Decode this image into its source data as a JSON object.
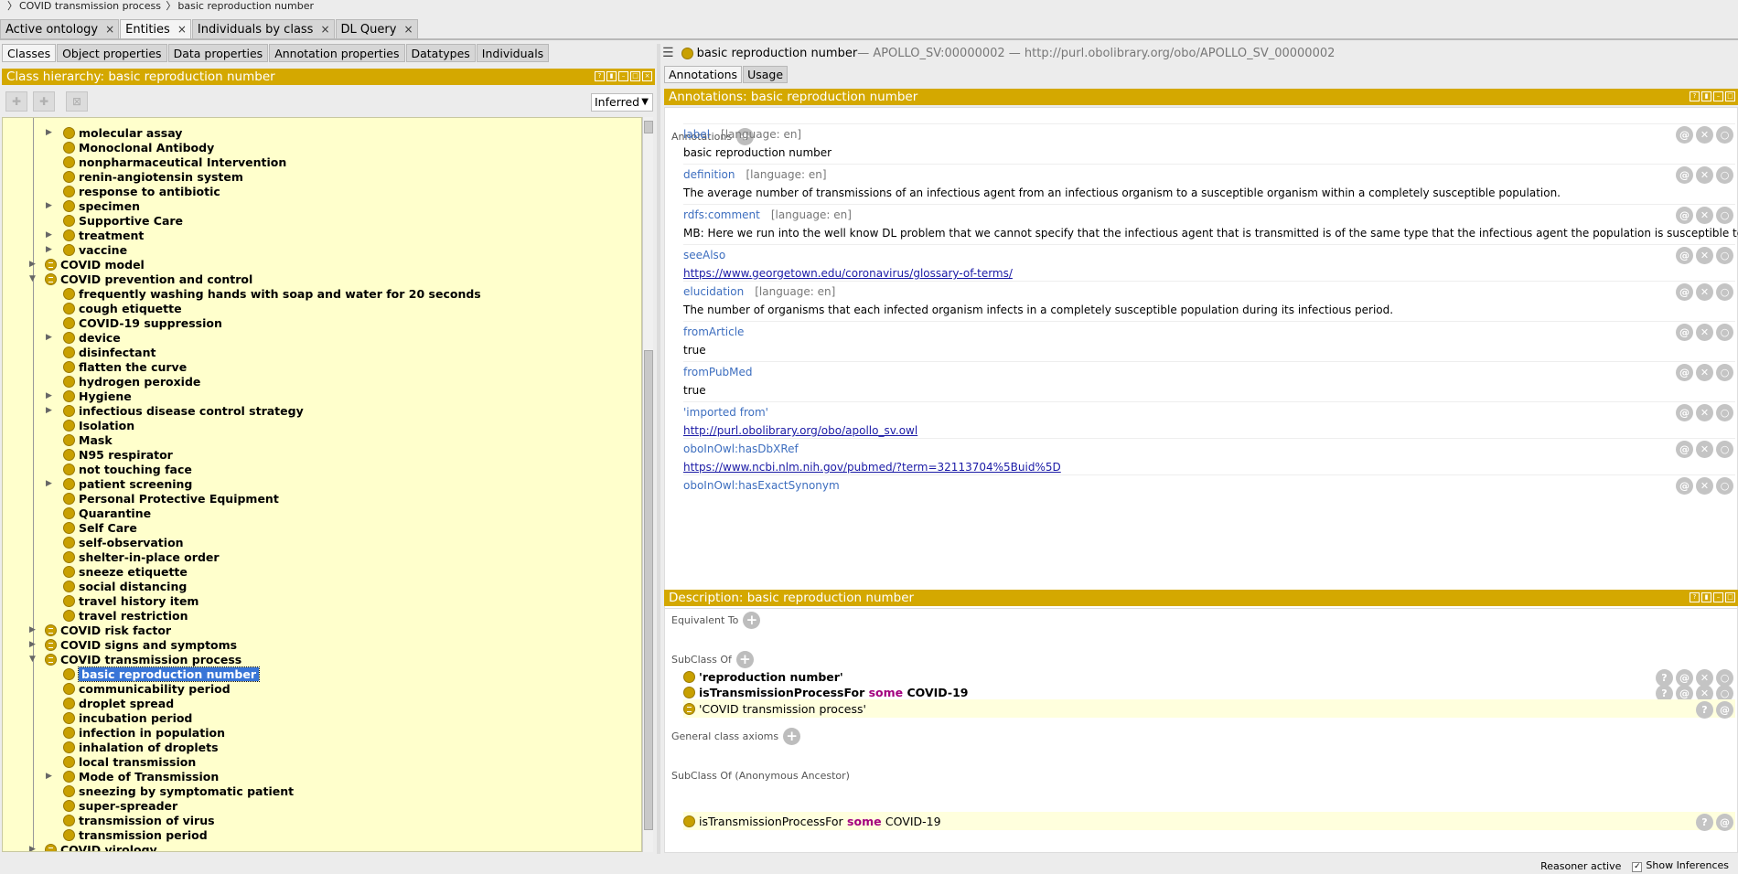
{
  "breadcrumb": [
    "COVID transmission process",
    "basic reproduction number"
  ],
  "top_tabs": [
    {
      "label": "Active ontology",
      "active": false
    },
    {
      "label": "Entities",
      "active": true
    },
    {
      "label": "Individuals by class",
      "active": false
    },
    {
      "label": "DL Query",
      "active": false
    }
  ],
  "left": {
    "sub_tabs": [
      "Classes",
      "Object properties",
      "Data properties",
      "Annotation properties",
      "Datatypes",
      "Individuals"
    ],
    "title": "Class hierarchy: basic reproduction number",
    "inferred": "Inferred",
    "tree": [
      {
        "label": "molecular assay",
        "depth": 2,
        "toggle": "collapsed",
        "type": "class",
        "bold": true
      },
      {
        "label": "Monoclonal Antibody",
        "depth": 2,
        "toggle": "",
        "type": "class"
      },
      {
        "label": "nonpharmaceutical Intervention",
        "depth": 2,
        "toggle": "",
        "type": "class"
      },
      {
        "label": "renin-angiotensin system",
        "depth": 2,
        "toggle": "",
        "type": "class"
      },
      {
        "label": "response to antibiotic",
        "depth": 2,
        "toggle": "",
        "type": "class"
      },
      {
        "label": "specimen",
        "depth": 2,
        "toggle": "collapsed",
        "type": "class"
      },
      {
        "label": "Supportive Care",
        "depth": 2,
        "toggle": "",
        "type": "class"
      },
      {
        "label": "treatment",
        "depth": 2,
        "toggle": "collapsed",
        "type": "class"
      },
      {
        "label": "vaccine",
        "depth": 2,
        "toggle": "collapsed",
        "type": "class"
      },
      {
        "label": "COVID model",
        "depth": 1,
        "toggle": "collapsed",
        "type": "eq"
      },
      {
        "label": "COVID prevention and control",
        "depth": 1,
        "toggle": "expanded",
        "type": "eq"
      },
      {
        "label": " frequently washing hands with soap and water for 20 seconds",
        "depth": 2,
        "toggle": "",
        "type": "class"
      },
      {
        "label": "cough etiquette",
        "depth": 2,
        "toggle": "",
        "type": "class"
      },
      {
        "label": "COVID-19 suppression",
        "depth": 2,
        "toggle": "",
        "type": "class"
      },
      {
        "label": "device",
        "depth": 2,
        "toggle": "collapsed",
        "type": "class"
      },
      {
        "label": "disinfectant",
        "depth": 2,
        "toggle": "",
        "type": "class"
      },
      {
        "label": "flatten the curve",
        "depth": 2,
        "toggle": "",
        "type": "class"
      },
      {
        "label": "hydrogen peroxide",
        "depth": 2,
        "toggle": "",
        "type": "class"
      },
      {
        "label": "Hygiene",
        "depth": 2,
        "toggle": "collapsed",
        "type": "class"
      },
      {
        "label": "infectious disease control strategy",
        "depth": 2,
        "toggle": "collapsed",
        "type": "class"
      },
      {
        "label": "Isolation",
        "depth": 2,
        "toggle": "",
        "type": "class"
      },
      {
        "label": "Mask",
        "depth": 2,
        "toggle": "",
        "type": "class"
      },
      {
        "label": "N95 respirator",
        "depth": 2,
        "toggle": "",
        "type": "class"
      },
      {
        "label": "not touching face",
        "depth": 2,
        "toggle": "",
        "type": "class"
      },
      {
        "label": "patient screening",
        "depth": 2,
        "toggle": "collapsed",
        "type": "class"
      },
      {
        "label": "Personal Protective Equipment",
        "depth": 2,
        "toggle": "",
        "type": "class"
      },
      {
        "label": "Quarantine",
        "depth": 2,
        "toggle": "",
        "type": "class"
      },
      {
        "label": "Self Care",
        "depth": 2,
        "toggle": "",
        "type": "class"
      },
      {
        "label": "self-observation",
        "depth": 2,
        "toggle": "",
        "type": "class"
      },
      {
        "label": "shelter-in-place order",
        "depth": 2,
        "toggle": "",
        "type": "class"
      },
      {
        "label": "sneeze etiquette",
        "depth": 2,
        "toggle": "",
        "type": "class"
      },
      {
        "label": "social distancing",
        "depth": 2,
        "toggle": "",
        "type": "class"
      },
      {
        "label": "travel history item",
        "depth": 2,
        "toggle": "",
        "type": "class"
      },
      {
        "label": "travel restriction",
        "depth": 2,
        "toggle": "",
        "type": "class"
      },
      {
        "label": "COVID risk factor",
        "depth": 1,
        "toggle": "collapsed",
        "type": "eq"
      },
      {
        "label": "COVID signs and symptoms",
        "depth": 1,
        "toggle": "collapsed",
        "type": "eq"
      },
      {
        "label": "COVID transmission process",
        "depth": 1,
        "toggle": "expanded",
        "type": "eq"
      },
      {
        "label": "basic reproduction number",
        "depth": 2,
        "toggle": "",
        "type": "class",
        "selected": true
      },
      {
        "label": "communicability period",
        "depth": 2,
        "toggle": "",
        "type": "class"
      },
      {
        "label": "droplet spread",
        "depth": 2,
        "toggle": "",
        "type": "class"
      },
      {
        "label": "incubation period",
        "depth": 2,
        "toggle": "",
        "type": "class"
      },
      {
        "label": "infection in population",
        "depth": 2,
        "toggle": "",
        "type": "class"
      },
      {
        "label": "inhalation of droplets",
        "depth": 2,
        "toggle": "",
        "type": "class"
      },
      {
        "label": "local transmission",
        "depth": 2,
        "toggle": "",
        "type": "class"
      },
      {
        "label": "Mode of Transmission",
        "depth": 2,
        "toggle": "collapsed",
        "type": "class"
      },
      {
        "label": "sneezing by symptomatic patient",
        "depth": 2,
        "toggle": "",
        "type": "class"
      },
      {
        "label": "super-spreader",
        "depth": 2,
        "toggle": "",
        "type": "class"
      },
      {
        "label": "transmission of virus",
        "depth": 2,
        "toggle": "",
        "type": "class"
      },
      {
        "label": "transmission period",
        "depth": 2,
        "toggle": "",
        "type": "class"
      },
      {
        "label": "COVID virology",
        "depth": 1,
        "toggle": "collapsed",
        "type": "eq"
      }
    ]
  },
  "right": {
    "entity_label": "basic reproduction number",
    "entity_id": " — APOLLO_SV:00000002 — http://purl.obolibrary.org/obo/APOLLO_SV_00000002",
    "tabs": [
      "Annotations",
      "Usage"
    ],
    "annotations_title": "Annotations: basic reproduction number",
    "annotations_header": "Annotations",
    "annotations": [
      {
        "prop": "label",
        "lang": "[language: en]",
        "value": "basic reproduction number",
        "link": false
      },
      {
        "prop": "definition",
        "lang": "[language: en]",
        "value": "The average number of transmissions of an infectious agent from an infectious organism to a susceptible organism within a completely susceptible population.",
        "link": false
      },
      {
        "prop": "rdfs:comment",
        "lang": "[language: en]",
        "value": "MB: Here we run into the well know DL problem that we cannot specify that the infectious agent that is transmitted is of the same type that the infectious agent the population is susceptible to.",
        "link": false
      },
      {
        "prop": "seeAlso",
        "lang": "",
        "value": "https://www.georgetown.edu/coronavirus/glossary-of-terms/",
        "link": true
      },
      {
        "prop": "elucidation",
        "lang": "[language: en]",
        "value": "The number of organisms that each infected organism infects in a completely susceptible population during its infectious period.",
        "link": false
      },
      {
        "prop": "fromArticle",
        "lang": "",
        "value": "true",
        "link": false
      },
      {
        "prop": "fromPubMed",
        "lang": "",
        "value": "true",
        "link": false
      },
      {
        "prop": "'imported from'",
        "lang": "",
        "value": "http://purl.obolibrary.org/obo/apollo_sv.owl",
        "link": true
      },
      {
        "prop": "oboInOwl:hasDbXRef",
        "lang": "",
        "value": "https://www.ncbi.nlm.nih.gov/pubmed/?term=32113704%5Buid%5D",
        "link": true
      },
      {
        "prop": "oboInOwl:hasExactSynonym",
        "lang": "",
        "value": "",
        "link": false
      }
    ],
    "description_title": "Description: basic reproduction number",
    "equivalent_to": "Equivalent To",
    "subclass_of": "SubClass Of",
    "subclasses": [
      {
        "pre": "'reproduction number'",
        "kw": "",
        "post": "",
        "bold": true,
        "inherited": false
      },
      {
        "pre": "isTransmissionProcessFor",
        "kw": " some ",
        "post": "COVID-19",
        "bold": true,
        "inherited": false
      },
      {
        "pre": "'COVID transmission process'",
        "kw": "",
        "post": "",
        "bold": false,
        "inherited": true
      }
    ],
    "general_class_axioms": "General class axioms",
    "subclass_of_anon": "SubClass Of (Anonymous Ancestor)",
    "anon_ancestor": {
      "pre": "isTransmissionProcessFor",
      "kw": " some ",
      "post": "COVID-19"
    }
  },
  "status": {
    "reasoner": "Reasoner active",
    "show_inferences": "Show Inferences"
  },
  "colors": {
    "accent": "#d4a800",
    "tree_bg": "#ffffcc",
    "selection": "#3875d7"
  }
}
